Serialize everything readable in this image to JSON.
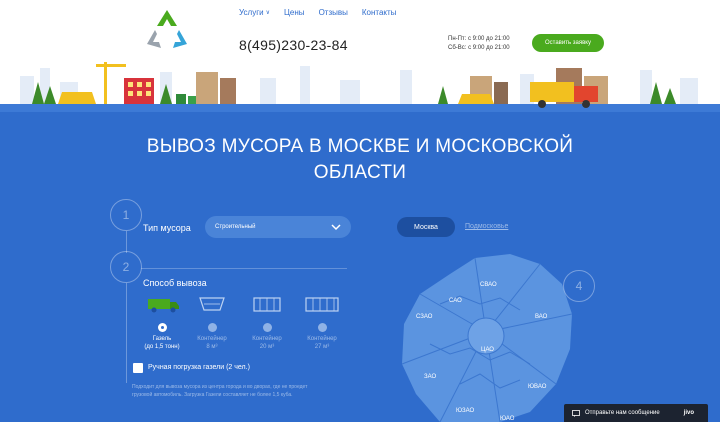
{
  "header": {
    "nav": [
      {
        "label": "Услуги",
        "dropdown": true
      },
      {
        "label": "Цены"
      },
      {
        "label": "Отзывы"
      },
      {
        "label": "Контакты"
      }
    ],
    "phone": "8(495)230-23-84",
    "hours_weekday": "Пн-Пт: с 9:00 до 21:00",
    "hours_weekend": "Сб-Вс: с 9:00 до 21:00",
    "cta_label": "Оставить заявку"
  },
  "hero": {
    "title_line1": "ВЫВОЗ МУСОРА В МОСКВЕ И МОСКОВСКОЙ",
    "title_line2": "ОБЛАСТИ"
  },
  "form": {
    "step1": "1",
    "step2": "2",
    "waste_type_label": "Тип мусора",
    "waste_type_value": "Строительный",
    "method_label": "Способ вывоза",
    "methods": [
      {
        "line1": "Газель",
        "line2": "(до 1,5 тонн)",
        "selected": true
      },
      {
        "line1": "Контейнер",
        "line2": "8 м³",
        "selected": false
      },
      {
        "line1": "Контейнер",
        "line2": "20 м³",
        "selected": false
      },
      {
        "line1": "Контейнер",
        "line2": "27 м³",
        "selected": false
      }
    ],
    "manual_loading_label": "Ручная погрузка газели (2 чел.)",
    "note_line1": "Подходит для вывоза мусора из центра города и во дворах, где не проедет",
    "note_line2": "грузовой автомобиль. Загрузка Газели составляет не более 1,5 куба."
  },
  "map": {
    "tab_active": "Москва",
    "tab_other": "Подмосковье",
    "step4": "4",
    "districts": [
      "СВАО",
      "САО",
      "СЗАО",
      "ВАО",
      "ЦАО",
      "ЗАО",
      "ЮВАО",
      "ЮЗАО",
      "ЮАО"
    ]
  },
  "chat": {
    "label": "Отправьте нам сообщение",
    "brand": "jivo"
  },
  "colors": {
    "accent_blue": "#2f6ccc",
    "cta_green": "#4aaa1e",
    "map_blue": "#5b94e0"
  }
}
